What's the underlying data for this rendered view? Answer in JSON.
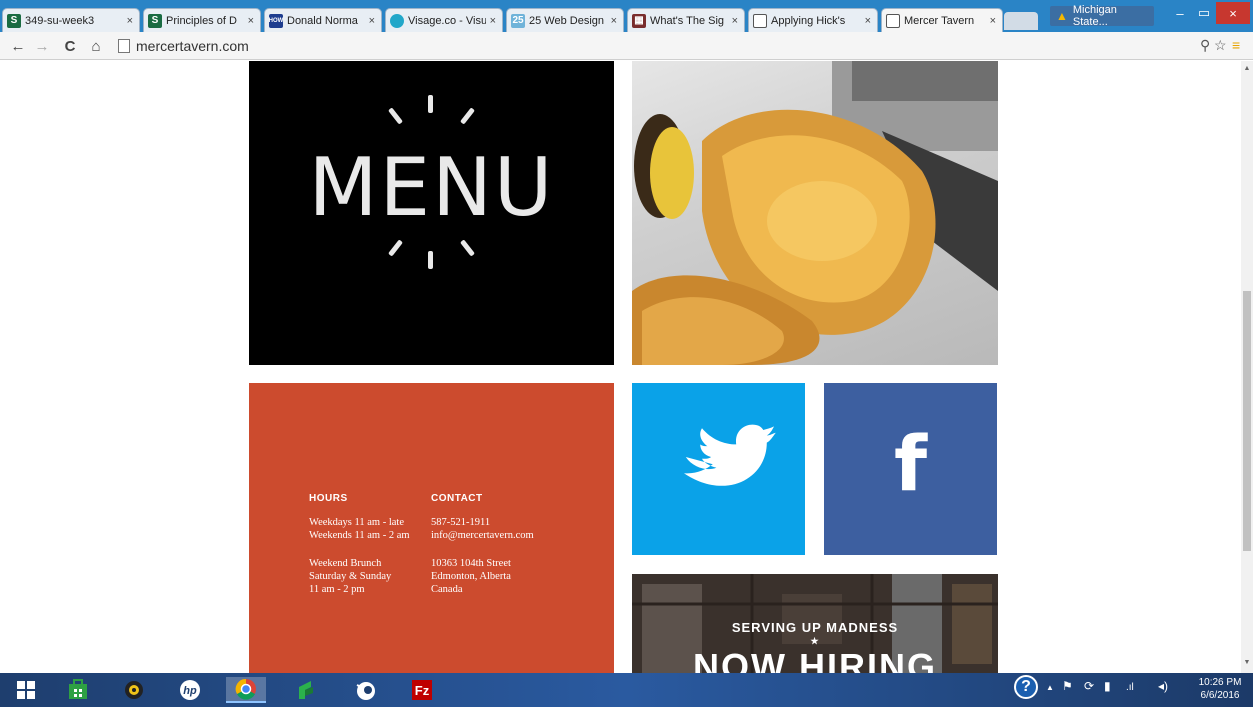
{
  "browser": {
    "tabs": [
      {
        "title": "349-su-week3",
        "favicon_letter": "S",
        "favicon_color": "#1a6b42"
      },
      {
        "title": "Principles of D",
        "favicon_letter": "S",
        "favicon_color": "#1a6b42"
      },
      {
        "title": "Donald Norma",
        "favicon_letter": "HOW",
        "favicon_color": "#1e3d8f"
      },
      {
        "title": "Visage.co - Visu",
        "favicon_letter": "",
        "favicon_color": "#22a7c9"
      },
      {
        "title": "25 Web Design",
        "favicon_letter": "25",
        "favicon_color": "#6fb3d9"
      },
      {
        "title": "What's The Sig",
        "favicon_letter": "▦",
        "favicon_color": "#7a2d2d"
      },
      {
        "title": "Applying Hick's",
        "favicon_letter": "",
        "favicon_color": "#ffffff"
      },
      {
        "title": "Mercer Tavern",
        "favicon_letter": "",
        "favicon_color": "#ffffff"
      }
    ],
    "tab_close_glyph": "×",
    "profile": "Michigan State...",
    "window_controls": {
      "minimize": "–",
      "maximize": "▭",
      "close": "×"
    },
    "url": "mercertavern.com",
    "nav": {
      "back": "←",
      "forward": "→",
      "reload": "C",
      "home": "⌂"
    },
    "zoom_glyph": "⚲",
    "star_glyph": "☆",
    "menu_glyph": "≡"
  },
  "page": {
    "menu_word": "MENU",
    "hours": {
      "heading": "HOURS",
      "weekdays": "Weekdays 11 am - late",
      "weekends": "Weekends 11 am - 2 am",
      "brunch_title": "Weekend Brunch",
      "brunch_days": "Saturday & Sunday",
      "brunch_time": "11 am - 2 pm"
    },
    "contact": {
      "heading": "CONTACT",
      "phone": "587-521-1911",
      "email": "info@mercertavern.com",
      "street": "10363 104th Street",
      "city": "Edmonton, Alberta",
      "country": "Canada"
    },
    "facebook_glyph": "f",
    "hiring_small": "SERVING UP MADNESS",
    "hiring_star": "★",
    "hiring_big": "NOW HIRING"
  },
  "taskbar": {
    "clock_time": "10:26 PM",
    "clock_date": "6/6/2016",
    "help_glyph": "?",
    "tray_up": "▲"
  },
  "colors": {
    "menu_bg": "#000000",
    "hours_bg": "#cc4b2e",
    "twitter_bg": "#0aa2e8",
    "facebook_bg": "#3d5fa0"
  }
}
